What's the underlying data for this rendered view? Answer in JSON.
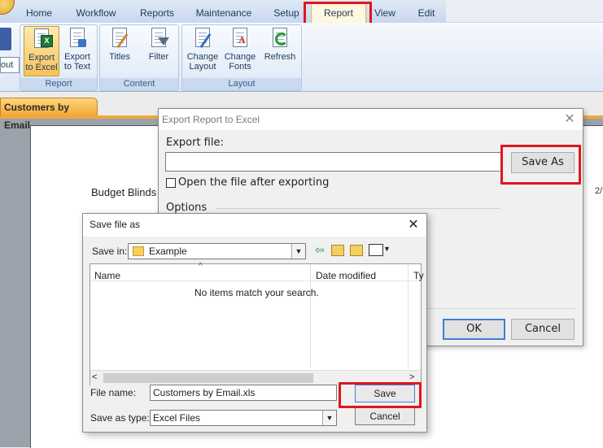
{
  "ribbon": {
    "tabs": [
      "Home",
      "Workflow",
      "Reports",
      "Maintenance",
      "Setup",
      "Report",
      "View",
      "Edit"
    ],
    "active_tab": "Report",
    "layout_fragment": "out",
    "groups": {
      "report": {
        "label": "Report",
        "buttons": [
          {
            "line1": "Export",
            "line2": "to Excel"
          },
          {
            "line1": "Export",
            "line2": "to Text"
          }
        ]
      },
      "content": {
        "label": "Content",
        "buttons": [
          {
            "line1": "Titles"
          },
          {
            "line1": "Filter"
          }
        ]
      },
      "layout": {
        "label": "Layout",
        "buttons": [
          {
            "line1": "Change",
            "line2": "Layout"
          },
          {
            "line1": "Change",
            "line2": "Fonts"
          },
          {
            "line1": "Refresh"
          }
        ]
      }
    }
  },
  "document_tab": "Customers by Email",
  "report_page": {
    "company": "Budget Blinds",
    "date_fragment": "2/"
  },
  "export_dialog": {
    "title": "Export Report to Excel",
    "export_file_label": "Export file:",
    "export_file_value": "",
    "save_as_label": "Save As",
    "open_after_label": "Open the file after exporting",
    "options_label": "Options",
    "ok_label": "OK",
    "cancel_label": "Cancel"
  },
  "save_dialog": {
    "title": "Save file as",
    "save_in_label": "Save in:",
    "save_in_value": "Example",
    "columns": [
      "Name",
      "Date modified",
      "Ty"
    ],
    "empty_message": "No items match your search.",
    "file_name_label": "File name:",
    "file_name_value": "Customers by Email.xls",
    "save_type_label": "Save as type:",
    "save_type_value": "Excel Files",
    "save_label": "Save",
    "cancel_label": "Cancel"
  },
  "colors": {
    "highlight": "#e0161c",
    "ribbon_blue": "#dce7f5",
    "doc_tab": "#f1a93a"
  }
}
